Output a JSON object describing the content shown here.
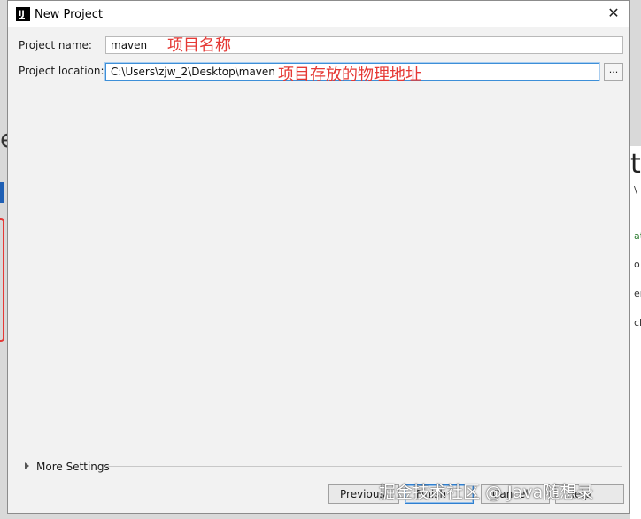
{
  "background": {
    "left_letter": "e",
    "right_letter": "t",
    "right_snippets": [
      "\\",
      "at",
      "o",
      "er",
      "cl"
    ]
  },
  "dialog": {
    "title": "New Project",
    "close_glyph": "✕",
    "project_name": {
      "label": "Project name:",
      "value": "maven",
      "annotation": "项目名称"
    },
    "project_location": {
      "label": "Project location:",
      "value": "C:\\Users\\zjw_2\\Desktop\\maven",
      "annotation": "项目存放的物理地址",
      "browse_label": "..."
    },
    "more_settings": {
      "label": "More Settings",
      "icon": "chevron-right-icon"
    },
    "buttons": {
      "previous": "Previous",
      "finish": "Finish",
      "cancel": "Cancel",
      "help": "Help"
    }
  },
  "watermark": "掘金技术社区 @ Java随想录",
  "colors": {
    "annotation": "#e53935",
    "focus": "#3d8fd8",
    "dialog_bg": "#f2f2f2"
  }
}
